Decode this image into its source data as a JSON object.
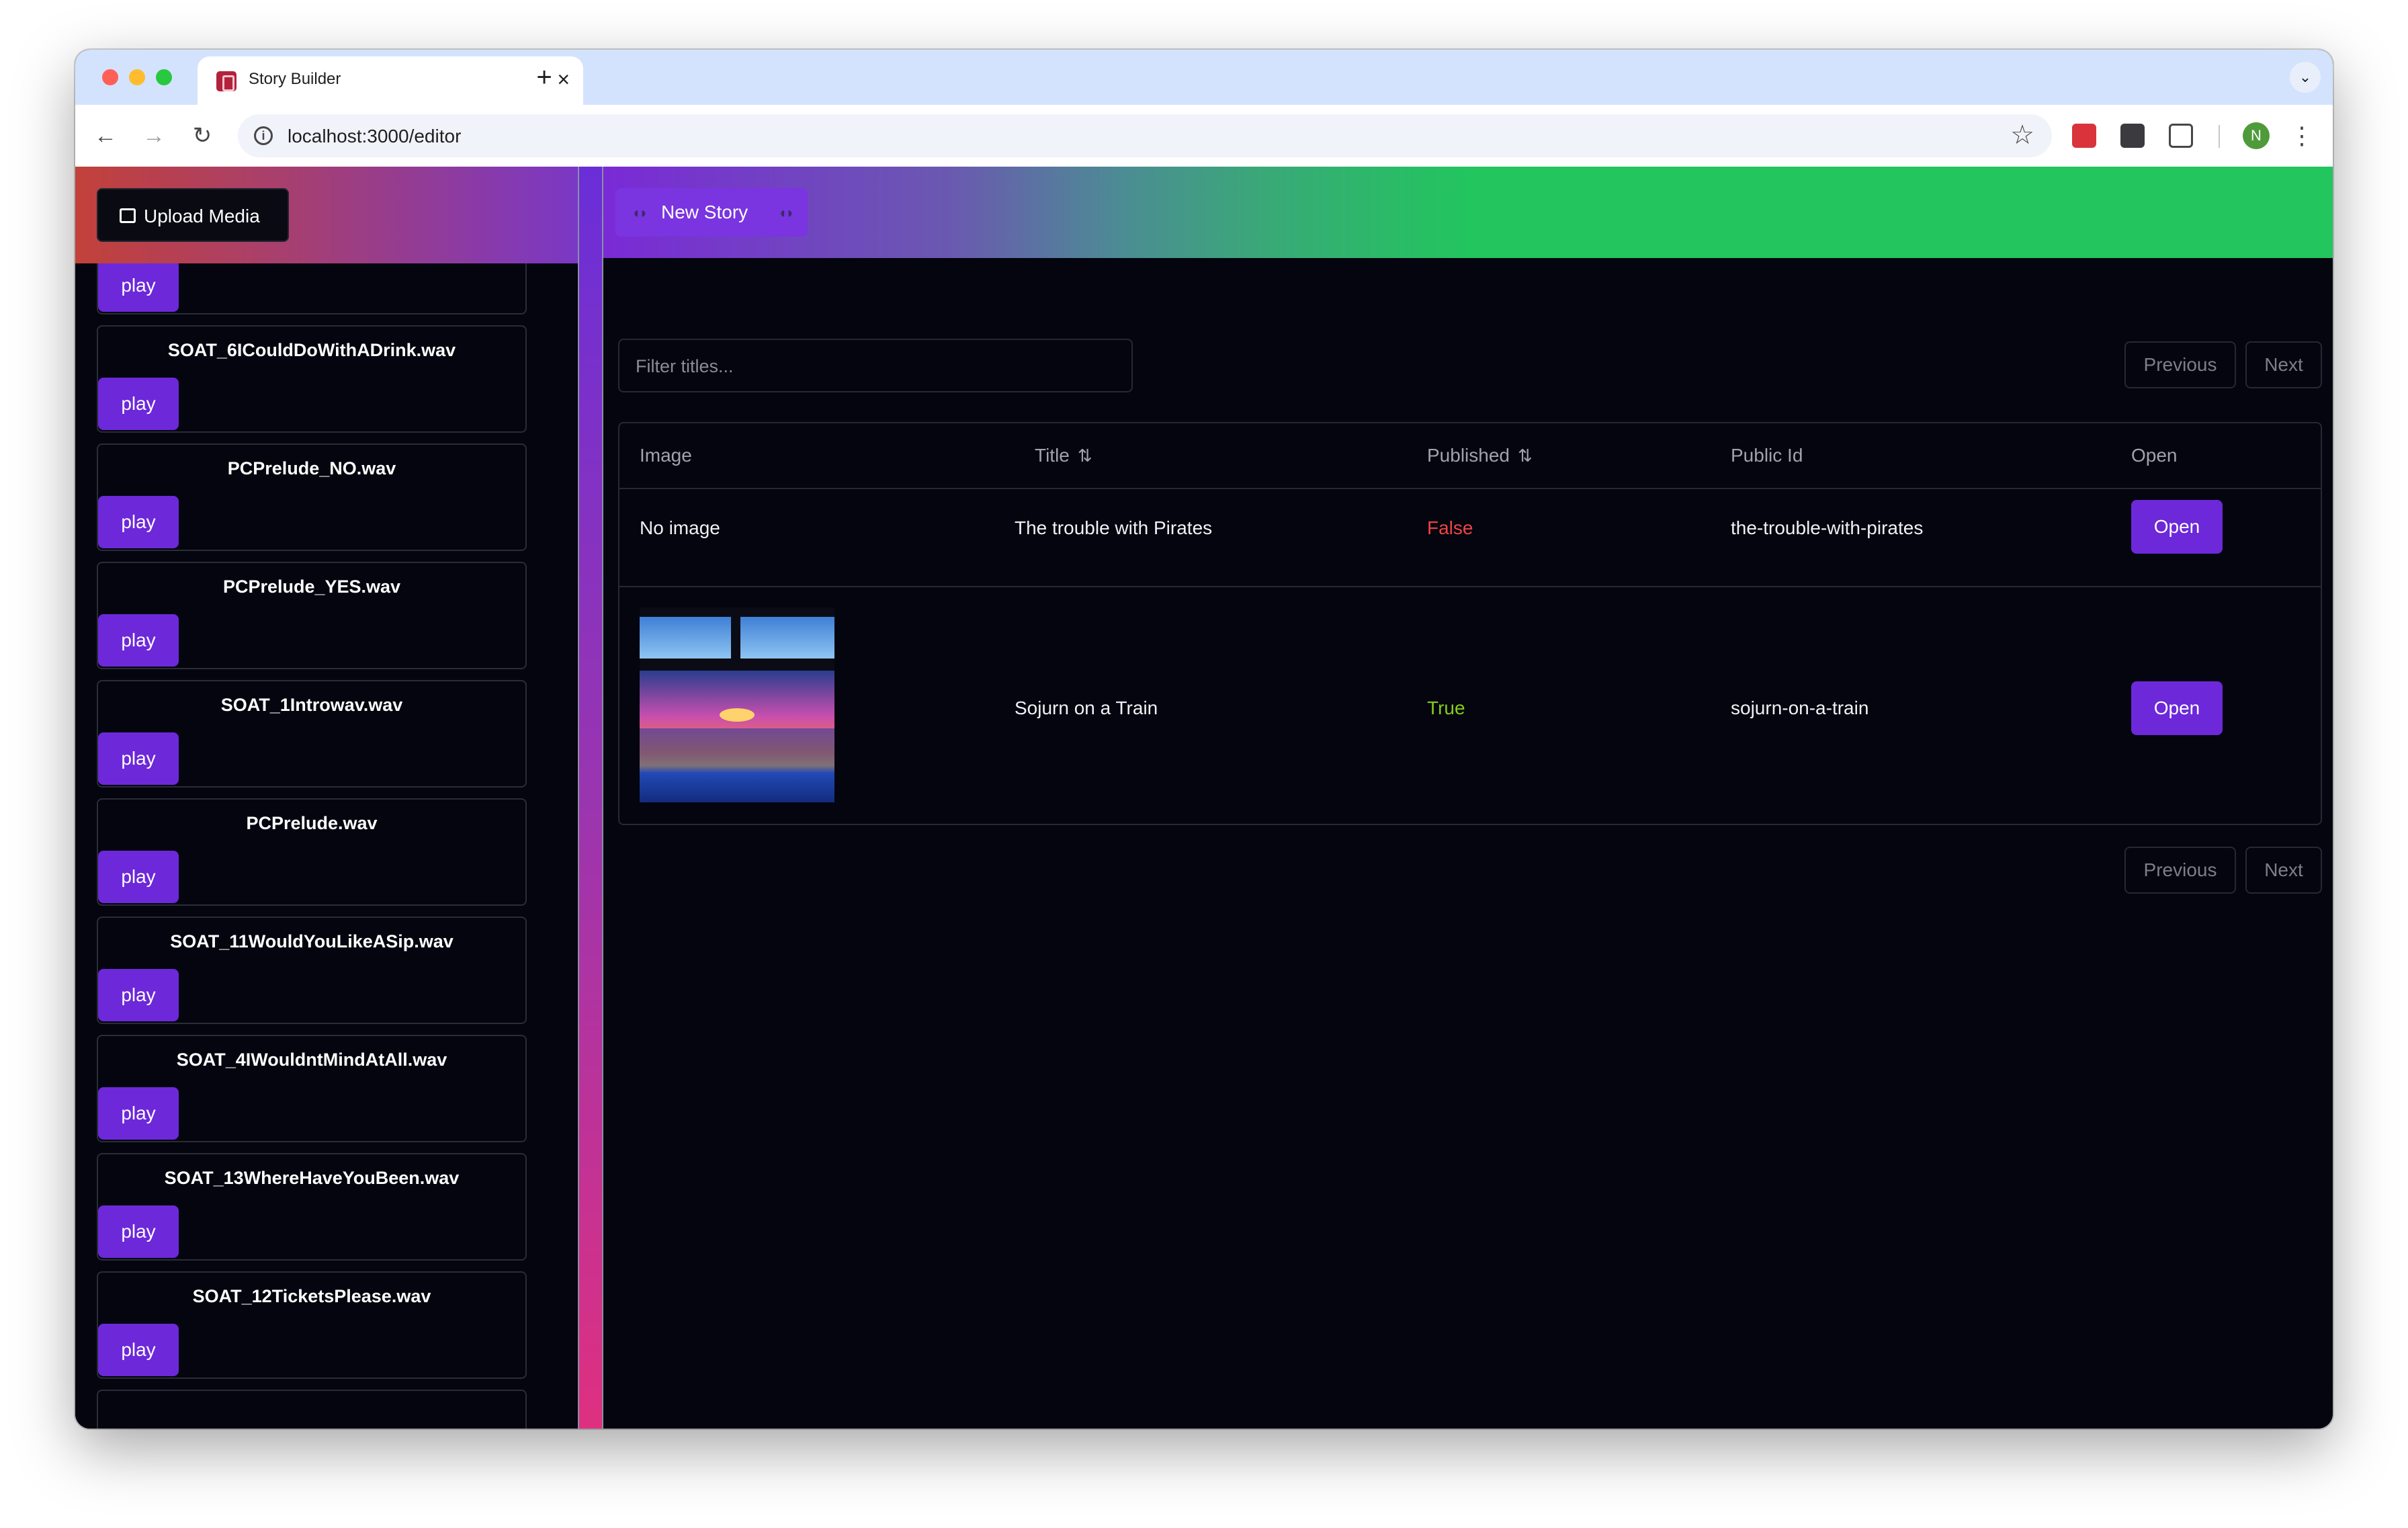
{
  "browser": {
    "tab_title": "Story Builder",
    "tab_close": "×",
    "new_tab": "+",
    "tabs_menu": "⌄",
    "url": "localhost:3000/editor",
    "avatar_initial": "N",
    "info_glyph": "i",
    "back_glyph": "←",
    "forward_glyph": "→",
    "reload_glyph": "↻",
    "star_glyph": "☆",
    "menu_glyph": "⋮",
    "traffic_lights": {
      "close": "#ff5f57",
      "minimize": "#febc2e",
      "maximize": "#28c840"
    }
  },
  "sidebar": {
    "upload_label": "Upload Media",
    "play_label": "play",
    "media_items": [
      {
        "name": ""
      },
      {
        "name": "SOAT_6ICouldDoWithADrink.wav"
      },
      {
        "name": "PCPrelude_NO.wav"
      },
      {
        "name": "PCPrelude_YES.wav"
      },
      {
        "name": "SOAT_1Introwav.wav"
      },
      {
        "name": "PCPrelude.wav"
      },
      {
        "name": "SOAT_11WouldYouLikeASip.wav"
      },
      {
        "name": "SOAT_4IWouldntMindAtAll.wav"
      },
      {
        "name": "SOAT_13WhereHaveYouBeen.wav"
      },
      {
        "name": "SOAT_12TicketsPlease.wav"
      }
    ]
  },
  "main": {
    "new_story_label": "New Story",
    "filter_placeholder": "Filter titles...",
    "pagination": {
      "previous": "Previous",
      "next": "Next"
    },
    "table": {
      "headers": {
        "image": "Image",
        "title": "Title",
        "published": "Published",
        "public_id": "Public Id",
        "open": "Open"
      },
      "sort_glyph": "⇅",
      "rows": [
        {
          "image": "No image",
          "title": "The trouble with Pirates",
          "published": "False",
          "public_id": "the-trouble-with-pirates",
          "open": "Open"
        },
        {
          "image": "",
          "title": "Sojurn on a Train",
          "published": "True",
          "public_id": "sojurn-on-a-train",
          "open": "Open"
        }
      ]
    }
  },
  "colors": {
    "accent": "#6d28d9",
    "false": "#ef4444",
    "true": "#84cc16",
    "header_green": "#22c55e"
  }
}
